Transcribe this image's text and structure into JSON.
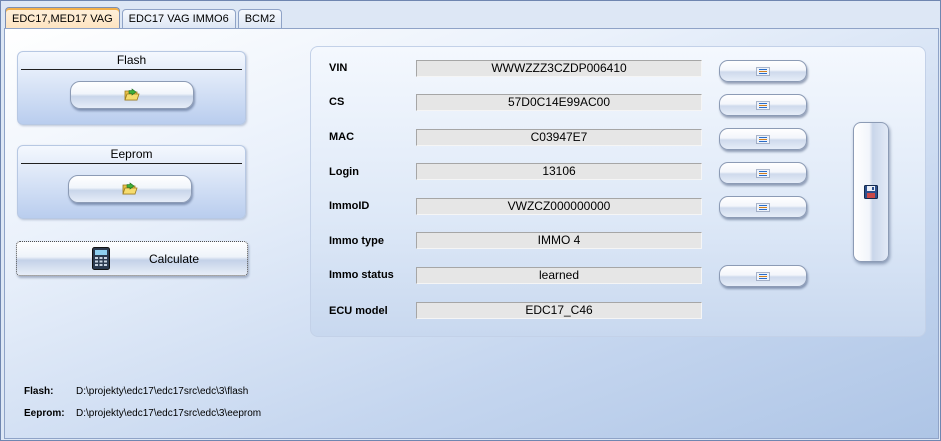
{
  "tabs": [
    {
      "label": "EDC17,MED17 VAG",
      "active": true
    },
    {
      "label": "EDC17 VAG IMMO6",
      "active": false
    },
    {
      "label": "BCM2",
      "active": false
    }
  ],
  "flash_panel": {
    "title": "Flash",
    "button_icon": "folder-open-icon"
  },
  "eeprom_panel": {
    "title": "Eeprom",
    "button_icon": "folder-open-icon"
  },
  "calculate": {
    "label": "Calculate",
    "icon": "calculator-icon"
  },
  "fields": [
    {
      "label": "VIN",
      "value": "WWWZZZ3CZDP006410"
    },
    {
      "label": "CS",
      "value": "57D0C14E99AC00"
    },
    {
      "label": "MAC",
      "value": "C03947E7"
    },
    {
      "label": "Login",
      "value": "13106"
    },
    {
      "label": "ImmoID",
      "value": "VWZCZ000000000"
    },
    {
      "label": "Immo type",
      "value": "IMMO 4"
    },
    {
      "label": "Immo status",
      "value": "learned"
    },
    {
      "label": "ECU model",
      "value": "EDC17_C46"
    }
  ],
  "save_button_icon": "floppy-disk-icon",
  "paths": {
    "flash_label": "Flash:",
    "flash_value": "D:\\projekty\\edc17\\edc17src\\edc\\3\\flash",
    "eeprom_label": "Eeprom:",
    "eeprom_value": "D:\\projekty\\edc17\\edc17src\\edc\\3\\eeprom"
  }
}
